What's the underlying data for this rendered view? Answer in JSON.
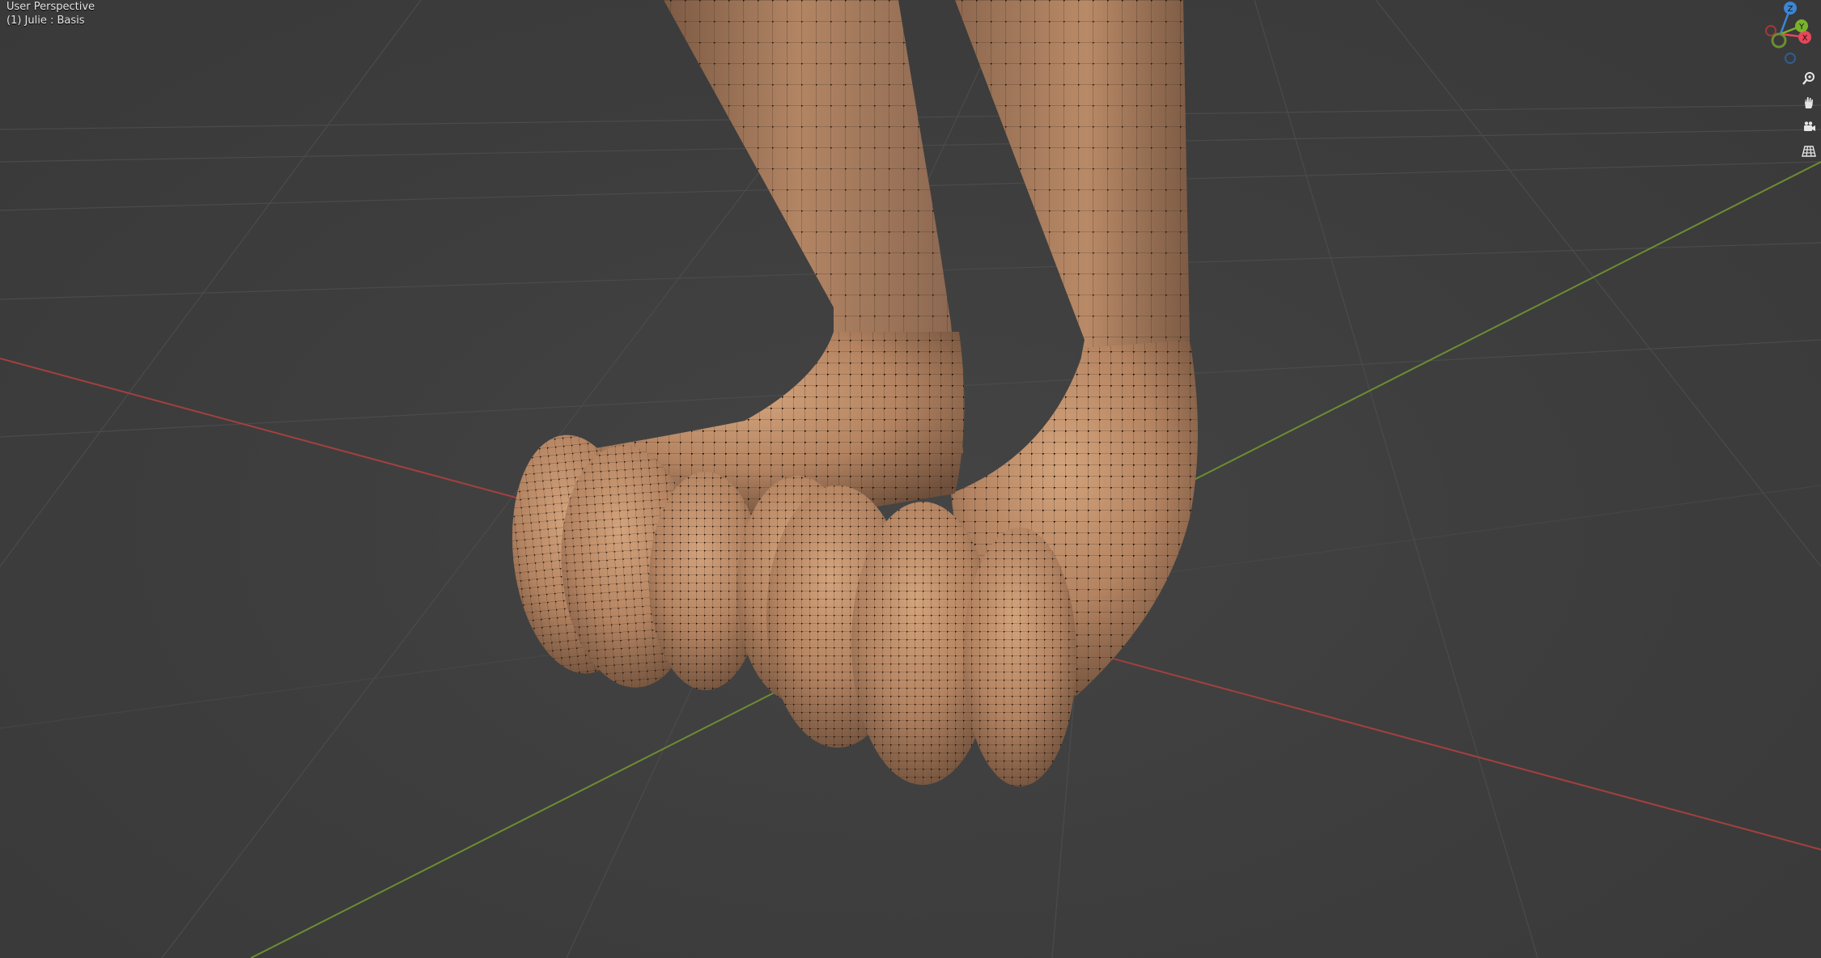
{
  "viewport": {
    "view_name": "User Perspective",
    "object_info": "(1) Julie : Basis"
  },
  "gizmo": {
    "axis_z_label": "Z",
    "axis_y_label": "Y",
    "axis_x_label": "X",
    "colors": {
      "x": "#e8465b",
      "y": "#79b32c",
      "z": "#3b86d6"
    }
  },
  "nav_tools": [
    {
      "name": "zoom-icon"
    },
    {
      "name": "hand-pan-icon"
    },
    {
      "name": "camera-icon"
    },
    {
      "name": "grid-ortho-icon"
    }
  ],
  "colors": {
    "background": "#3d3d3d",
    "grid": "#4a4a4a",
    "x_axis": "#a03a3a",
    "y_axis": "#6a8a2f",
    "skin": "#b98a68",
    "skin_shadow": "#7a5a44",
    "wire": "#1a1209"
  }
}
